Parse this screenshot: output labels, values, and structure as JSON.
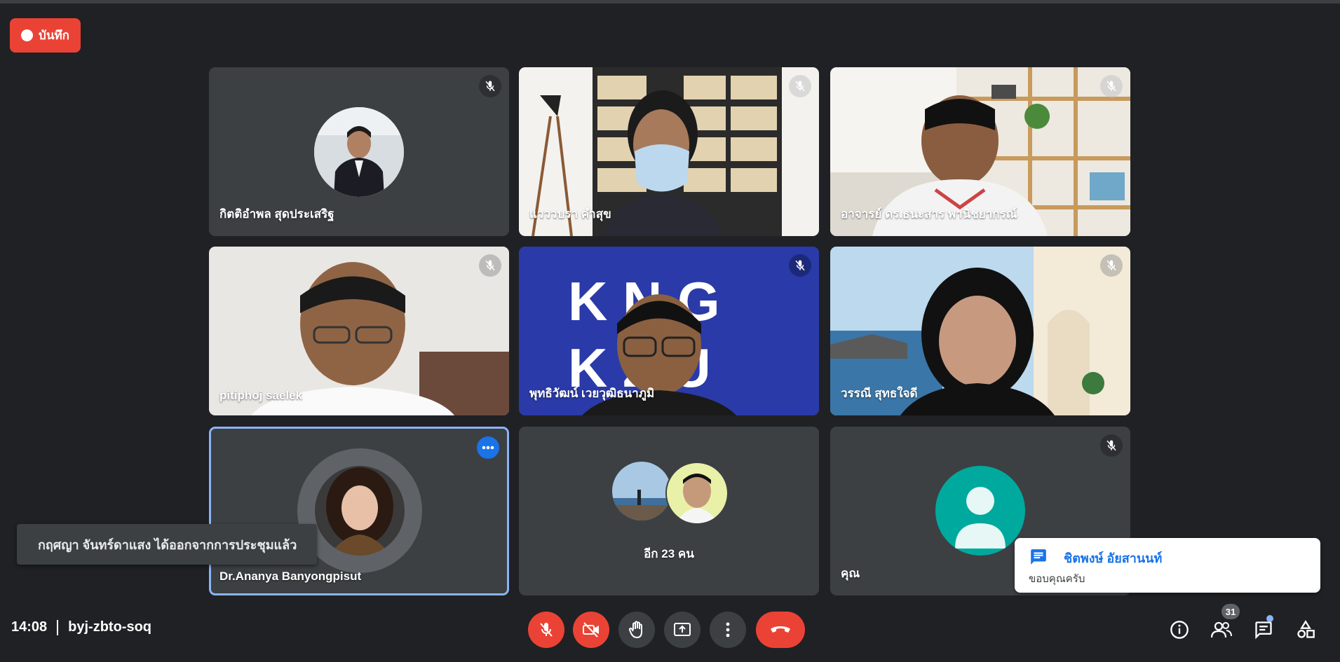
{
  "recording": {
    "label": "บันทึก",
    "color": "#ea4335"
  },
  "tiles": [
    {
      "name": "กิตติอำพล สุดประเสริฐ",
      "type": "avatar",
      "muted": true
    },
    {
      "name": "แวววบรา คำสุข",
      "type": "video",
      "muted": true
    },
    {
      "name": "อาจารย์ ดร.ธนะสาร พานิชยากรณ์",
      "type": "video",
      "muted": true
    },
    {
      "name": "pitiphoj saelek",
      "type": "video",
      "muted": true
    },
    {
      "name": "พุทธิวัฒน์ เวยวุฒิธนาภูมิ",
      "type": "video",
      "muted": true
    },
    {
      "name": "วรรณี สุทธใจดี",
      "type": "video",
      "muted": true
    },
    {
      "name": "Dr.Ananya Banyongpisut",
      "type": "avatar",
      "active": true
    },
    {
      "name": "อีก 23 คน",
      "type": "others"
    },
    {
      "name": "คุณ",
      "type": "self",
      "muted": true
    }
  ],
  "video_banner": {
    "line1": "K  N  G",
    "line2": "K  Z  U"
  },
  "toast": {
    "text": "กฤศญา จันทร์ดาแสง ได้ออกจากการประชุมแล้ว"
  },
  "chat_popup": {
    "sender": "ชิตพงษ์ อัยสานนท์",
    "message": "ขอบคุณครับ"
  },
  "meeting": {
    "time": "14:08",
    "code": "byj-zbto-soq"
  },
  "controls": [
    "mic-off",
    "camera-off",
    "raise-hand",
    "present",
    "more-options",
    "leave-call"
  ],
  "right_controls": {
    "participants_count": "31"
  },
  "colors": {
    "accent": "#1a73e8",
    "danger": "#ea4335",
    "bg": "#202124",
    "tile": "#3c4043"
  }
}
